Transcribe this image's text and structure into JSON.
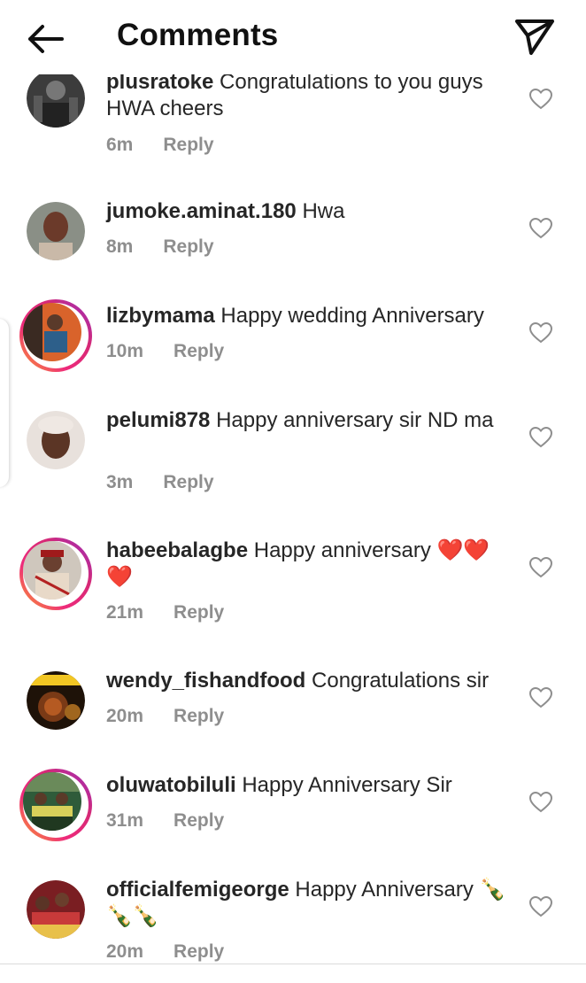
{
  "header": {
    "title": "Comments",
    "back_icon": "arrow-left-icon",
    "send_icon": "paper-plane-icon"
  },
  "reply_label": "Reply",
  "comments": [
    {
      "username": "plusratoke",
      "text": "Congratulations to you guys HWA cheers",
      "time": "6m",
      "story_ring": false
    },
    {
      "username": "jumoke.aminat.180",
      "text": "Hwa",
      "time": "8m",
      "story_ring": false
    },
    {
      "username": "lizbymama",
      "text": "Happy wedding Anniversary",
      "time": "10m",
      "story_ring": true
    },
    {
      "username": "pelumi878",
      "text": "Happy anniversary sir ND ma",
      "time": "3m",
      "story_ring": false
    },
    {
      "username": "habeebalagbe",
      "text": "Happy anniversary ❤️❤️❤️",
      "time": "21m",
      "story_ring": true
    },
    {
      "username": "wendy_fishandfood",
      "text": "Congratulations sir",
      "time": "20m",
      "story_ring": false
    },
    {
      "username": "oluwatobiluli",
      "text": "Happy Anniversary Sir",
      "time": "31m",
      "story_ring": true
    },
    {
      "username": "officialfemigeorge",
      "text": "Happy Anniversary 🍾🍾🍾",
      "time": "20m",
      "story_ring": false
    }
  ],
  "colors": {
    "text": "#262626",
    "meta": "#8e8e8e",
    "ring_start": "#f9a42a",
    "ring_end": "#962fbf",
    "heart_red": "#e0245e"
  }
}
